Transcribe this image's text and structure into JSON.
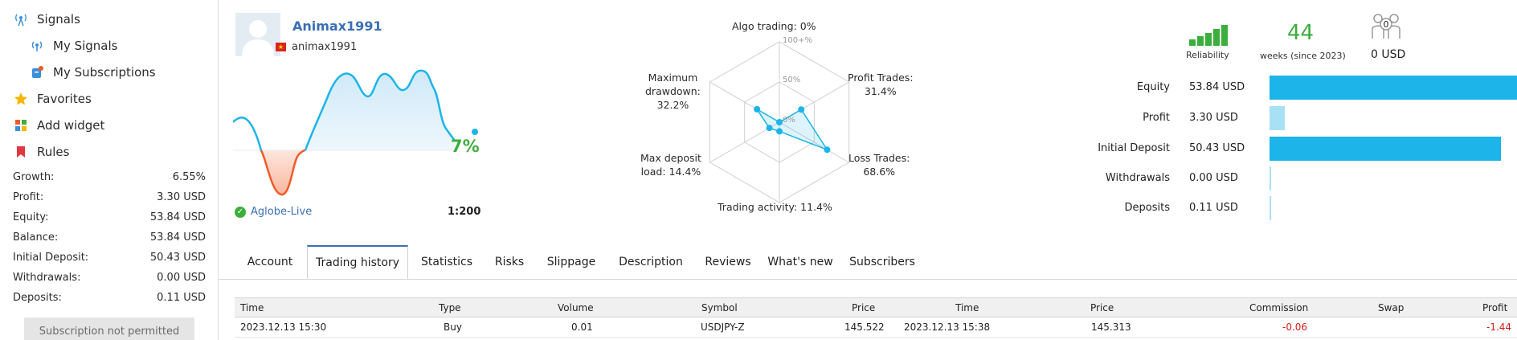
{
  "sidebar": {
    "nav": [
      {
        "label": "Signals",
        "icon": "signal-antenna-icon"
      },
      {
        "label": "My Signals",
        "icon": "my-signals-icon"
      },
      {
        "label": "My Subscriptions",
        "icon": "subscriptions-icon"
      },
      {
        "label": "Favorites",
        "icon": "star-icon"
      },
      {
        "label": "Add widget",
        "icon": "widget-icon"
      },
      {
        "label": "Rules",
        "icon": "bookmark-icon"
      }
    ],
    "stats": [
      {
        "label": "Growth:",
        "value": "6.55%"
      },
      {
        "label": "Profit:",
        "value": "3.30 USD"
      },
      {
        "label": "Equity:",
        "value": "53.84 USD"
      },
      {
        "label": "Balance:",
        "value": "53.84 USD"
      },
      {
        "label": "Initial Deposit:",
        "value": "50.43 USD"
      },
      {
        "label": "Withdrawals:",
        "value": "0.00 USD"
      },
      {
        "label": "Deposits:",
        "value": "0.11 USD"
      }
    ],
    "subscription_button": "Subscription not permitted"
  },
  "profile": {
    "name": "Animax1991",
    "login": "animax1991",
    "flag_icon": "vietnam-flag-icon",
    "growth": "7%",
    "broker": "Aglobe-Live",
    "leverage": "1:200"
  },
  "radar": {
    "labels": {
      "algo": "Algo trading: 0%",
      "profit_trades_title": "Profit Trades:",
      "profit_trades_value": "31.4%",
      "loss_trades_title": "Loss Trades:",
      "loss_trades_value": "68.6%",
      "activity": "Trading activity: 11.4%",
      "max_deposit_load_title": "Max deposit",
      "max_deposit_load_value": "load: 14.4%",
      "max_drawdown_title": "Maximum",
      "max_drawdown_mid": "drawdown:",
      "max_drawdown_value": "32.2%"
    },
    "scale": {
      "top": "100+%",
      "mid": "50%",
      "zero": "0%"
    },
    "values": [
      {
        "axis": "Algo trading",
        "value": 0
      },
      {
        "axis": "Profit Trades",
        "value": 31.4
      },
      {
        "axis": "Loss Trades",
        "value": 68.6
      },
      {
        "axis": "Trading activity",
        "value": 11.4
      },
      {
        "axis": "Max deposit load",
        "value": 14.4
      },
      {
        "axis": "Maximum drawdown",
        "value": 32.2
      }
    ]
  },
  "summary": {
    "reliability_label": "Reliability",
    "reliability_bars": 5,
    "weeks": "44",
    "weeks_label": "weeks (since 2023)",
    "subscribers_count": "0",
    "subscribers_funds": "0 USD"
  },
  "chart_data": {
    "type": "bar",
    "orientation": "horizontal",
    "categories": [
      "Equity",
      "Profit",
      "Initial Deposit",
      "Withdrawals",
      "Deposits"
    ],
    "value_labels": [
      "53.84 USD",
      "3.30 USD",
      "50.43 USD",
      "0.00 USD",
      "0.11 USD"
    ],
    "values": [
      53.84,
      3.3,
      50.43,
      0.0,
      0.11
    ],
    "xlim": [
      0,
      53.84
    ],
    "color": "#1cb4e9"
  },
  "tabs": [
    "Account",
    "Trading history",
    "Statistics",
    "Risks",
    "Slippage",
    "Description",
    "Reviews",
    "What's new",
    "Subscribers"
  ],
  "active_tab": "Trading history",
  "table": {
    "headers": [
      "Time",
      "Type",
      "Volume",
      "Symbol",
      "Price",
      "Time",
      "Price",
      "Commission",
      "Swap",
      "Profit"
    ],
    "rows": [
      [
        "2023.12.13 15:30",
        "Buy",
        "0.01",
        "USDJPY-Z",
        "145.522",
        "2023.12.13 15:38",
        "145.313",
        "-0.06",
        "",
        "-1.44"
      ]
    ]
  },
  "colors": {
    "accent": "#1cb4e9",
    "link": "#3b6fb6",
    "positive": "#3cae3c",
    "negative": "#d91b1b",
    "growth_down": "#f05a28"
  }
}
